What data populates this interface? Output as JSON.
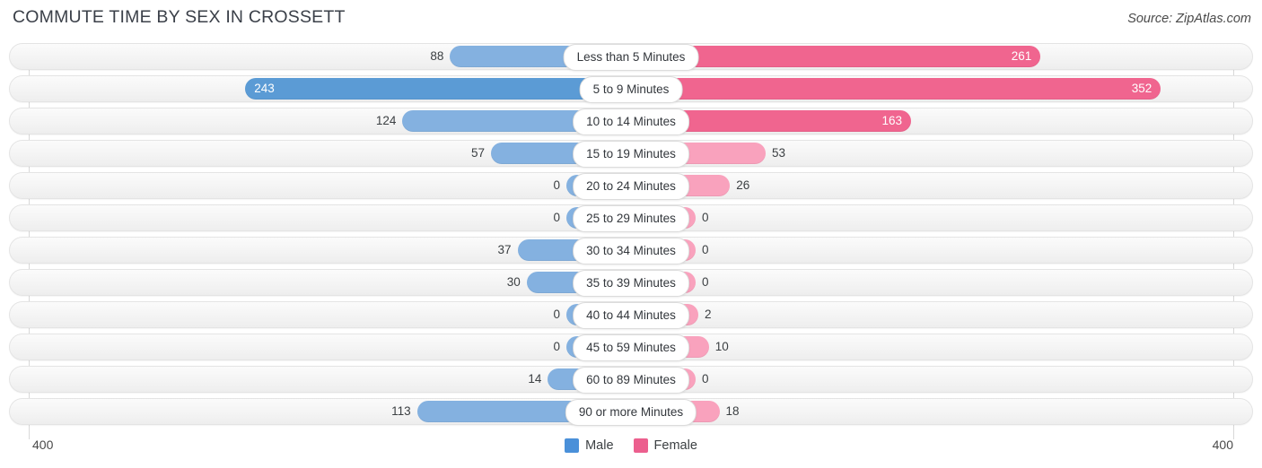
{
  "header": {
    "title": "COMMUTE TIME BY SEX IN CROSSETT",
    "source": "Source: ZipAtlas.com"
  },
  "axis": {
    "left_tick": "400",
    "right_tick": "400",
    "max": 400
  },
  "legend": {
    "items": [
      {
        "label": "Male",
        "color": "#4a90d9"
      },
      {
        "label": "Female",
        "color": "#ec5f8e"
      }
    ]
  },
  "colors": {
    "male_strong": "#5b9bd5",
    "male_light": "#84b1e0",
    "female_strong": "#f0658f",
    "female_light": "#f9a2bd",
    "track": "#f4f4f4"
  },
  "chart_data": {
    "type": "bar",
    "orientation": "horizontal-diverging",
    "title": "COMMUTE TIME BY SEX IN CROSSETT",
    "xlabel": "",
    "ylabel": "",
    "xlim": [
      400,
      400
    ],
    "grid": false,
    "legend_position": "bottom-center",
    "categories": [
      "Less than 5 Minutes",
      "5 to 9 Minutes",
      "10 to 14 Minutes",
      "15 to 19 Minutes",
      "20 to 24 Minutes",
      "25 to 29 Minutes",
      "30 to 34 Minutes",
      "35 to 39 Minutes",
      "40 to 44 Minutes",
      "45 to 59 Minutes",
      "60 to 89 Minutes",
      "90 or more Minutes"
    ],
    "series": [
      {
        "name": "Male",
        "values": [
          88,
          243,
          124,
          57,
          0,
          0,
          37,
          30,
          0,
          0,
          14,
          113
        ]
      },
      {
        "name": "Female",
        "values": [
          261,
          352,
          163,
          53,
          26,
          0,
          0,
          0,
          2,
          10,
          0,
          18
        ]
      }
    ]
  },
  "rows": [
    {
      "label": "Less than 5 Minutes",
      "male": "88",
      "female": "261"
    },
    {
      "label": "5 to 9 Minutes",
      "male": "243",
      "female": "352"
    },
    {
      "label": "10 to 14 Minutes",
      "male": "124",
      "female": "163"
    },
    {
      "label": "15 to 19 Minutes",
      "male": "57",
      "female": "53"
    },
    {
      "label": "20 to 24 Minutes",
      "male": "0",
      "female": "26"
    },
    {
      "label": "25 to 29 Minutes",
      "male": "0",
      "female": "0"
    },
    {
      "label": "30 to 34 Minutes",
      "male": "37",
      "female": "0"
    },
    {
      "label": "35 to 39 Minutes",
      "male": "30",
      "female": "0"
    },
    {
      "label": "40 to 44 Minutes",
      "male": "0",
      "female": "2"
    },
    {
      "label": "45 to 59 Minutes",
      "male": "0",
      "female": "10"
    },
    {
      "label": "60 to 89 Minutes",
      "male": "14",
      "female": "0"
    },
    {
      "label": "90 or more Minutes",
      "male": "113",
      "female": "18"
    }
  ]
}
